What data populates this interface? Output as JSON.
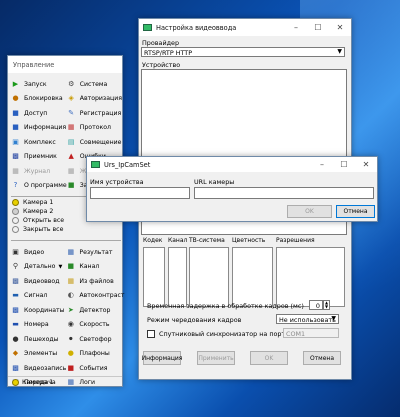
{
  "video_settings": {
    "title": "Настройка видеоввода",
    "provider_label": "Провайдер",
    "provider_value": "RTSP/RTP HTTP",
    "device_label": "Устройство",
    "columns": [
      "Кодек",
      "Канал",
      "ТВ-система",
      "Цветность",
      "Разрешения"
    ],
    "delay_label": "Временная задержка в обработке кадров (мс)",
    "delay_value": "0",
    "interleave_label": "Режим чередования кадров",
    "interleave_value": "Не использовать",
    "sync_label": "Спутниковый синхронизатор на порту",
    "sync_port": "COM1",
    "buttons": {
      "info": "Информация",
      "apply": "Применить",
      "ok": "OK",
      "cancel": "Отмена"
    }
  },
  "control": {
    "title": "Управление",
    "menu_left": [
      "Запуск",
      "Блокировка",
      "Доступ",
      "Информация",
      "Комплекс",
      "Приемник",
      "Журнал",
      "О программе"
    ],
    "menu_right": [
      "Система",
      "Авторизация",
      "Регистрация",
      "Протокол",
      "Совмещение",
      "Ошибки",
      "Журнал",
      "Зап"
    ],
    "cameras": [
      "Камера 1",
      "Камера 2"
    ],
    "open_all": "Открыть все",
    "close_all": "Закрыть все",
    "modules_left": [
      "Видео",
      "Детально",
      "Видеоввод",
      "Сигнал",
      "Координаты",
      "Номера",
      "Пешеходы",
      "Элементы",
      "Видеозапись",
      "Передача"
    ],
    "modules_right": [
      "Результат",
      "Канал",
      "Из файлов",
      "Автоконтраст",
      "Детектор",
      "Скорость",
      "Светофор",
      "Плафоны",
      "События",
      "Логи"
    ],
    "status_camera": "Камера 1"
  },
  "ipcam_dialog": {
    "title": "Urs_IpCamSet",
    "device_name_label": "Имя устройства",
    "url_label": "URL камеры",
    "device_name_value": "",
    "url_value": "",
    "ok": "OK",
    "cancel": "Отмена"
  }
}
